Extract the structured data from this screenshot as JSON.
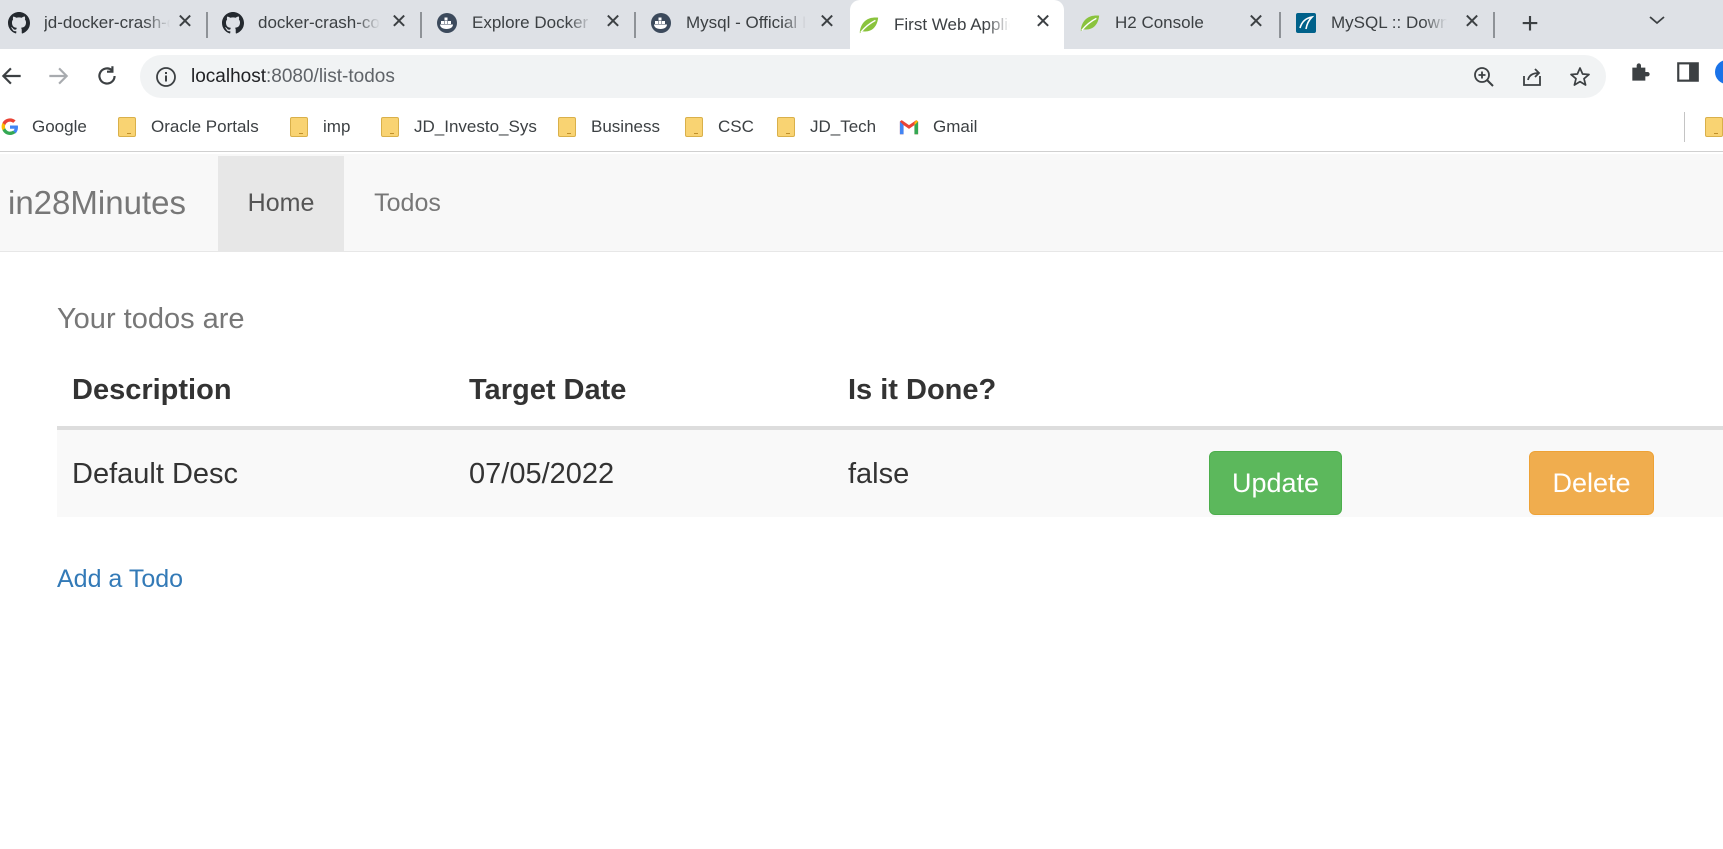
{
  "browser": {
    "tabs": [
      {
        "title": "jd-docker-crash-course",
        "favicon": "github-icon",
        "active": false
      },
      {
        "title": "docker-crash-course",
        "favicon": "github-icon",
        "active": false
      },
      {
        "title": "Explore Docker Hub",
        "favicon": "docker-icon",
        "active": false
      },
      {
        "title": "Mysql - Official Image",
        "favicon": "docker-icon",
        "active": false
      },
      {
        "title": "First Web Application",
        "favicon": "spring-leaf-icon",
        "active": true
      },
      {
        "title": "H2 Console",
        "favicon": "spring-leaf-icon",
        "active": false
      },
      {
        "title": "MySQL :: Download",
        "favicon": "mysql-icon",
        "active": false
      }
    ],
    "url_host": "localhost",
    "url_path": ":8080/list-todos",
    "bookmarks": [
      {
        "label": "Google",
        "icon": "google-icon"
      },
      {
        "label": "Oracle Portals",
        "icon": "folder-icon"
      },
      {
        "label": "imp",
        "icon": "folder-icon"
      },
      {
        "label": "JD_Investo_Sys",
        "icon": "folder-icon"
      },
      {
        "label": "Business",
        "icon": "folder-icon"
      },
      {
        "label": "CSC",
        "icon": "folder-icon"
      },
      {
        "label": "JD_Tech",
        "icon": "folder-icon"
      },
      {
        "label": "Gmail",
        "icon": "gmail-icon"
      }
    ]
  },
  "app": {
    "brand": "in28Minutes",
    "nav": [
      {
        "label": "Home",
        "active": true
      },
      {
        "label": "Todos",
        "active": false
      }
    ],
    "heading": "Your todos are",
    "table": {
      "headers": [
        "Description",
        "Target Date",
        "Is it Done?"
      ],
      "rows": [
        {
          "description": "Default Desc",
          "target_date": "07/05/2022",
          "done": "false",
          "update_label": "Update",
          "delete_label": "Delete"
        }
      ]
    },
    "add_link": "Add a Todo"
  },
  "colors": {
    "success": "#5cb85c",
    "warning": "#f0ad4e",
    "link": "#337ab7"
  }
}
